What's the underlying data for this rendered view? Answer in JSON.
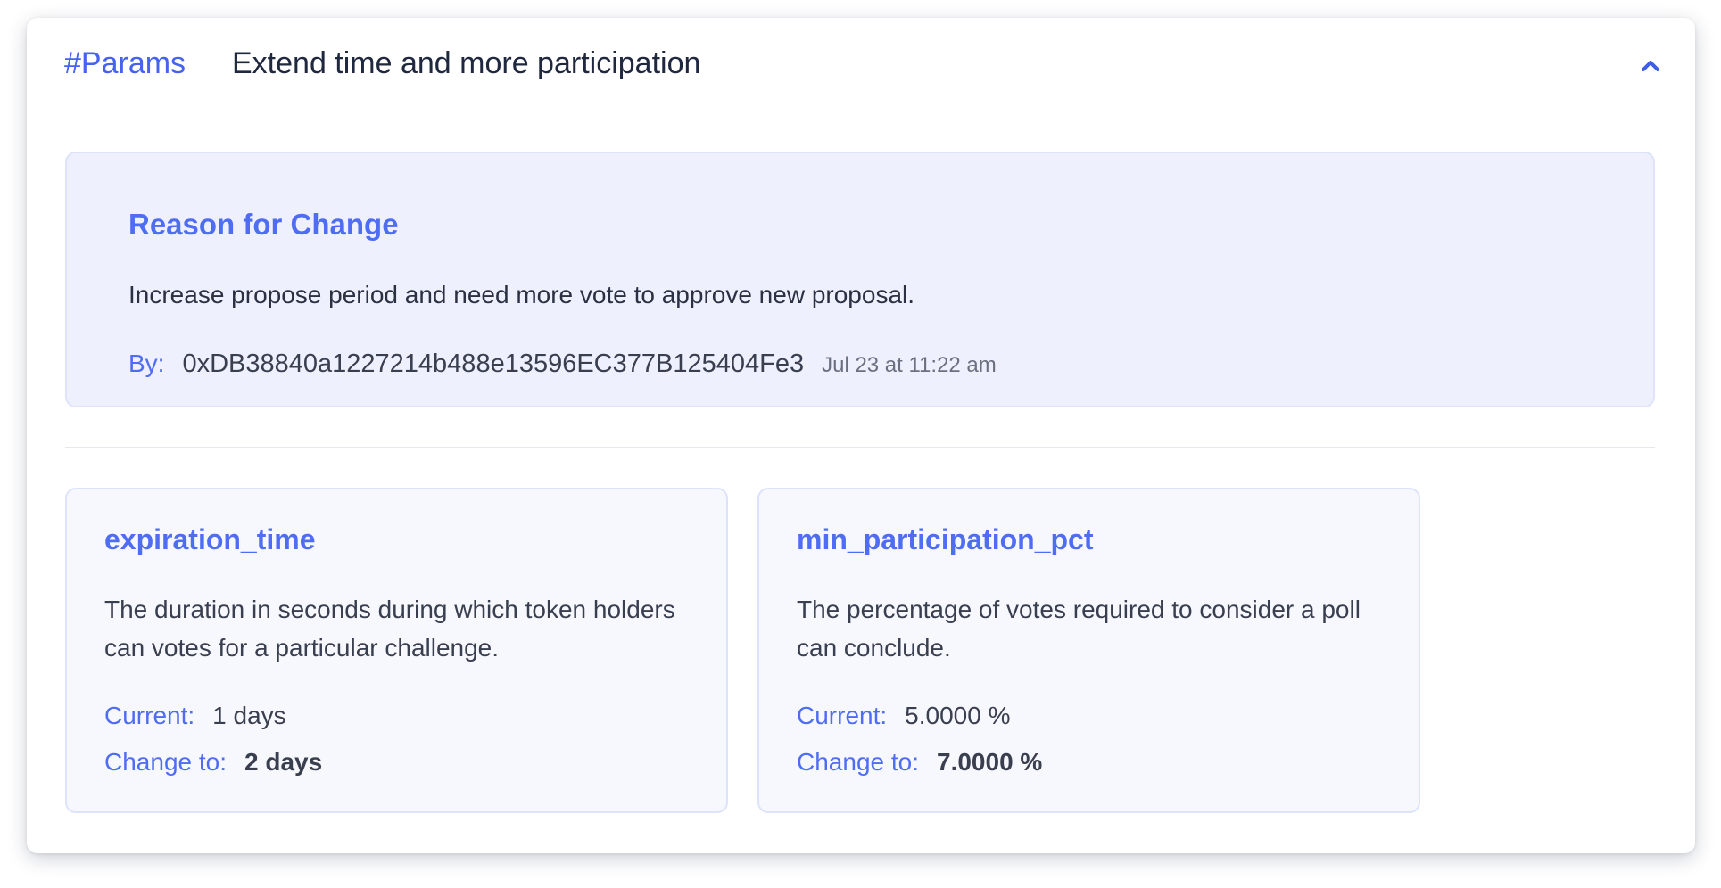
{
  "header": {
    "tag": "#Params",
    "title": "Extend time and more participation"
  },
  "reason": {
    "title": "Reason for Change",
    "text": "Increase propose period and need more vote to approve new proposal.",
    "by_label": "By:",
    "address": "0xDB38840a1227214b488e13596EC377B125404Fe3",
    "date": "Jul 23 at 11:22 am"
  },
  "params": [
    {
      "name": "expiration_time",
      "description": "The duration in seconds during which token holders can votes for a particular challenge.",
      "current_label": "Current:",
      "current_value": "1 days",
      "change_label": "Change to:",
      "change_value": "2 days"
    },
    {
      "name": "min_participation_pct",
      "description": "The percentage of votes required to consider a poll can conclude.",
      "current_label": "Current:",
      "current_value": "5.0000 %",
      "change_label": "Change to:",
      "change_value": "7.0000 %"
    }
  ],
  "icons": {
    "collapse": "chevron-up-icon"
  },
  "colors": {
    "accent": "#4f6df2",
    "panel_bg": "#eef1fd",
    "param_bg": "#f7f8fe"
  }
}
